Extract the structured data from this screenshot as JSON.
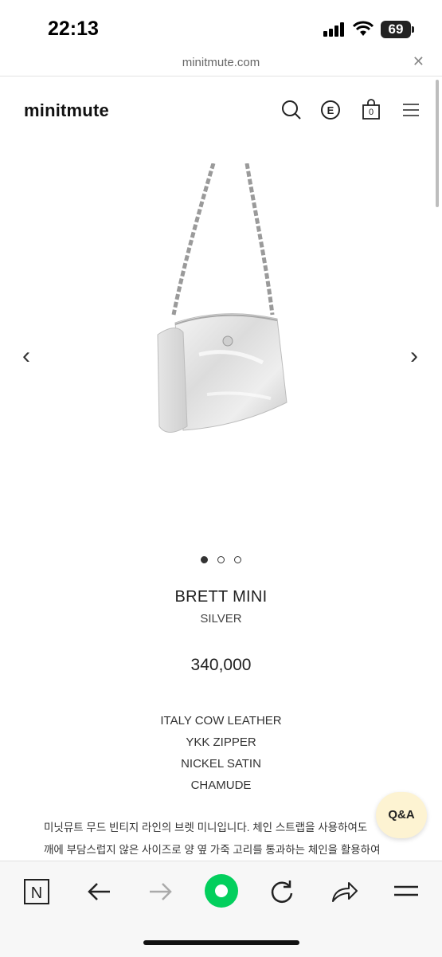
{
  "status_bar": {
    "time": "22:13",
    "battery": "69"
  },
  "browser": {
    "url": "minitmute.com",
    "close_glyph": "✕"
  },
  "header": {
    "logo": "minitmute",
    "cart_count": "0"
  },
  "gallery": {
    "prev_glyph": "‹",
    "next_glyph": "›",
    "slide_count": 3,
    "active_slide": 1
  },
  "product": {
    "name": "BRETT MINI",
    "color": "SILVER",
    "price": "340,000",
    "specs": [
      "ITALY COW LEATHER",
      "YKK ZIPPER",
      "NICKEL SATIN",
      "CHAMUDE"
    ],
    "description_lines": [
      "미닛뮤트 무드 빈티지 라인의 브렛 미니입니다. 체인 스트랩을 사용하여도",
      "깨에 부담스럽지 않은 사이즈로 양 옆 가죽 고리를 통과하는 체인을 활용하여"
    ]
  },
  "qa_button": {
    "label": "Q&A"
  },
  "icons": [
    "search-icon",
    "e-icon",
    "cart-icon",
    "menu-icon",
    "back-icon",
    "forward-icon",
    "refresh-icon",
    "share-icon",
    "naver-icon",
    "green-dot-icon"
  ]
}
